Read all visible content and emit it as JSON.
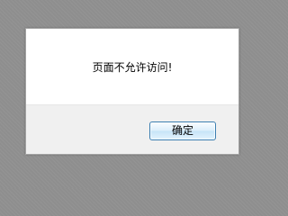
{
  "dialog": {
    "message": "页面不允许访问!",
    "ok_button_label": "确定"
  }
}
